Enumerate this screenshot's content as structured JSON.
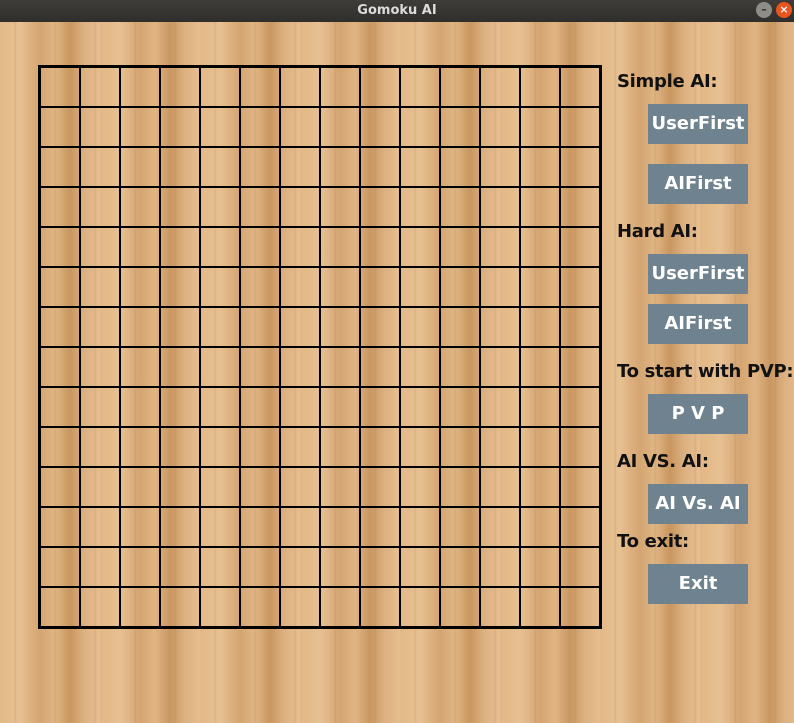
{
  "window": {
    "title": "Gomoku AI",
    "minimize_glyph": "–",
    "close_glyph": "×"
  },
  "board": {
    "rows": 14,
    "cols": 14
  },
  "panel": {
    "simple_ai_label": "Simple AI:",
    "simple_user_first": "UserFirst",
    "simple_ai_first": "AIFirst",
    "hard_ai_label": "Hard AI:",
    "hard_user_first": "UserFirst",
    "hard_ai_first": "AIFirst",
    "pvp_label": "To start with PVP:",
    "pvp_button": "P V P",
    "ai_vs_ai_label": "AI VS. AI:",
    "ai_vs_ai_button": "AI Vs. AI",
    "exit_label": "To exit:",
    "exit_button": "Exit"
  },
  "colors": {
    "button_bg": "#6f8290",
    "grid_line": "#000000",
    "wood": "#d9ae7c",
    "close_btn": "#e9541f"
  }
}
